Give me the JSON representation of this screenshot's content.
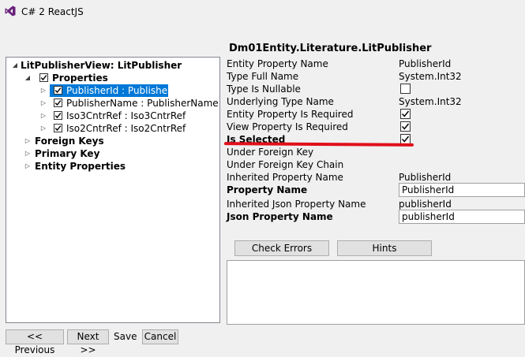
{
  "app": {
    "title": "C# 2 ReactJS"
  },
  "entity": {
    "title": "Dm01Entity.Literature.LitPublisher"
  },
  "tree": {
    "root_label": "LitPublisherView: LitPublisher",
    "properties_label": "Properties",
    "property_items": [
      {
        "label": "PublisherId : PublisherId",
        "checked": true,
        "selected": true
      },
      {
        "label": "PublisherName : PublisherName",
        "checked": true,
        "selected": false
      },
      {
        "label": "Iso3CntrRef : Iso3CntrRef",
        "checked": true,
        "selected": false
      },
      {
        "label": "Iso2CntrRef : Iso2CntrRef",
        "checked": true,
        "selected": false
      }
    ],
    "foreign_keys_label": "Foreign Keys",
    "primary_key_label": "Primary Key",
    "entity_properties_label": "Entity Properties"
  },
  "props": {
    "entity_property_name": {
      "label": "Entity Property Name",
      "value": "PublisherId"
    },
    "type_full_name": {
      "label": "Type Full Name",
      "value": "System.Int32"
    },
    "type_is_nullable": {
      "label": "Type Is Nullable",
      "checked": false
    },
    "underlying_type_name": {
      "label": "Underlying Type Name",
      "value": "System.Int32"
    },
    "entity_property_required": {
      "label": "Entity Property Is Required",
      "checked": true
    },
    "view_property_required": {
      "label": "View Property Is Required",
      "checked": true
    },
    "is_selected": {
      "label": "Is Selected",
      "checked": true
    },
    "under_foreign_key": {
      "label": "Under Foreign Key"
    },
    "under_foreign_key_chain": {
      "label": "Under Foreign Key Chain"
    },
    "inherited_property_name": {
      "label": "Inherited Property Name",
      "value": "PublisherId"
    },
    "property_name": {
      "label": "Property Name",
      "value": "PublisherId"
    },
    "inherited_json_property_name": {
      "label": "Inherited Json Property Name",
      "value": "publisherId"
    },
    "json_property_name": {
      "label": "Json Property Name",
      "value": "publisherId"
    }
  },
  "buttons": {
    "check_errors": "Check Errors",
    "hints": "Hints",
    "previous": "<< Previous",
    "next": "Next >>",
    "save": "Save",
    "cancel": "Cancel"
  },
  "colors": {
    "selection": "#0078d7",
    "annotation_underline": "#e0101a",
    "vs_logo": "#68217a"
  }
}
